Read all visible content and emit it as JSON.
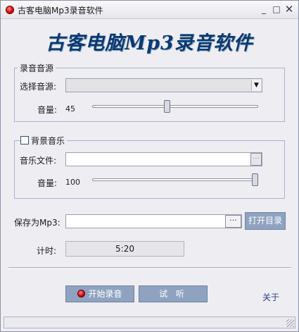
{
  "window": {
    "title": "古客电脑Mp3录音软件",
    "controls": {
      "minimize": "_",
      "maximize": "□",
      "close": "✕"
    }
  },
  "banner": {
    "text": "古客电脑Mp3录音软件"
  },
  "record_source": {
    "legend": "录音音源",
    "source_label": "选择音源:",
    "source_value": "",
    "volume_label": "音量:",
    "volume_value": "45",
    "volume_fraction": 0.45
  },
  "background_music": {
    "legend": "背景音乐",
    "checked": false,
    "file_label": "音乐文件:",
    "file_value": "",
    "browse_label": "···",
    "volume_label": "音量:",
    "volume_value": "100",
    "volume_fraction": 1.0
  },
  "save": {
    "label": "保存为Mp3:",
    "value": "",
    "browse_label": "···",
    "open_dir_label": "打开目录"
  },
  "timer": {
    "label": "计时:",
    "value": "5:20"
  },
  "actions": {
    "start_label": "开始录音",
    "test_label": "试 听",
    "about_label": "关于"
  },
  "icons": {
    "app": "record-icon",
    "dropdown": "chevron-down-icon",
    "start": "record-icon"
  },
  "colors": {
    "banner": "#0a3a70",
    "button": "#8fa3c0",
    "record_red": "#d40000",
    "link": "#2a3b8f"
  }
}
